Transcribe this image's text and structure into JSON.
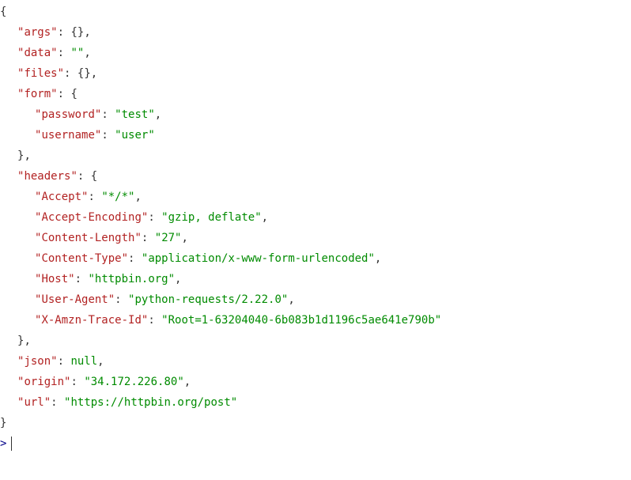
{
  "json": {
    "args_key": "args",
    "args_value": "{}",
    "data_key": "data",
    "data_value": "\"\"",
    "files_key": "files",
    "files_value": "{}",
    "form_key": "form",
    "form": {
      "password_key": "password",
      "password_value": "test",
      "username_key": "username",
      "username_value": "user"
    },
    "headers_key": "headers",
    "headers": {
      "accept_key": "Accept",
      "accept_value": "*/*",
      "accept_encoding_key": "Accept-Encoding",
      "accept_encoding_value": "gzip, deflate",
      "content_length_key": "Content-Length",
      "content_length_value": "27",
      "content_type_key": "Content-Type",
      "content_type_value": "application/x-www-form-urlencoded",
      "host_key": "Host",
      "host_value": "httpbin.org",
      "user_agent_key": "User-Agent",
      "user_agent_value": "python-requests/2.22.0",
      "trace_id_key": "X-Amzn-Trace-Id",
      "trace_id_value": "Root=1-63204040-6b083b1d1196c5ae641e790b"
    },
    "json_key": "json",
    "json_value": "null",
    "origin_key": "origin",
    "origin_value": "34.172.226.80",
    "url_key": "url",
    "url_value": "https://httpbin.org/post"
  },
  "prompt": ">"
}
